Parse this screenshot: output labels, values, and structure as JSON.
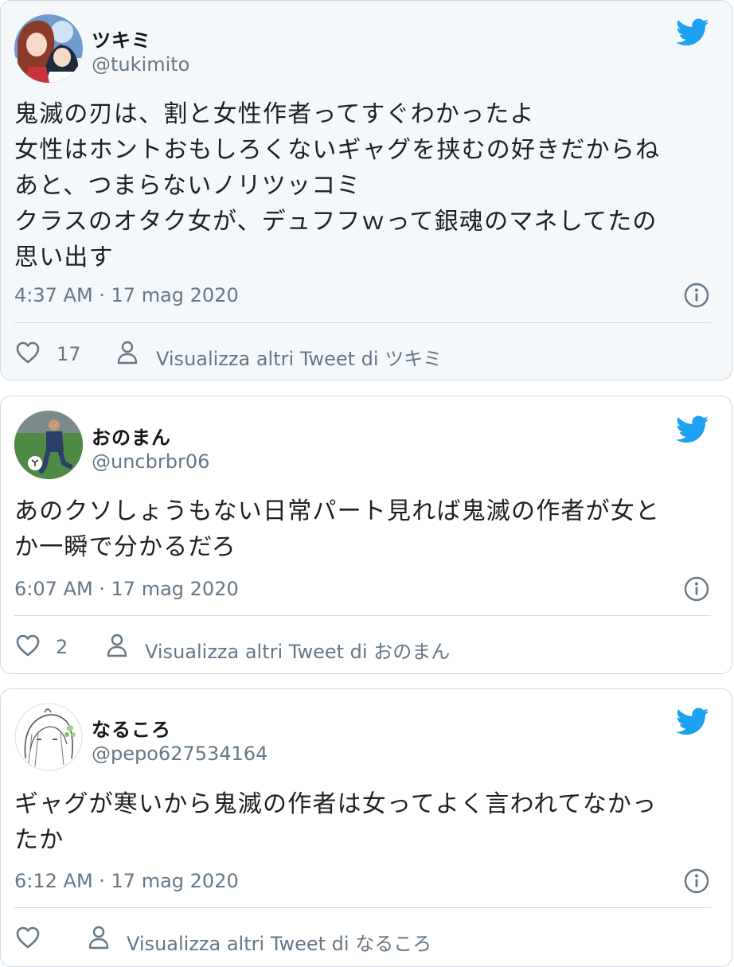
{
  "tweets": [
    {
      "display_name": "ツキミ",
      "handle": "@tukimito",
      "text_lines": [
        "鬼滅の刃は、割と女性作者ってすぐわかったよ",
        "女性はホントおもしろくないギャグを挟むの好きだからね",
        "あと、つまらないノリツッコミ",
        "クラスのオタク女が、デュフフｗって銀魂のマネしてたの",
        "思い出す"
      ],
      "timestamp": "4:37 AM · 17 mag 2020",
      "likes": "17",
      "more_label": "Visualizza altri Tweet di ツキミ",
      "avatar_icon": "anime-girls-avatar"
    },
    {
      "display_name": "おのまん",
      "handle": "@uncbrbr06",
      "text_lines": [
        "あのクソしょうもない日常パート見れば鬼滅の作者が女と",
        "か一瞬で分かるだろ"
      ],
      "timestamp": "6:07 AM · 17 mag 2020",
      "likes": "2",
      "more_label": "Visualizza altri Tweet di おのまん",
      "avatar_icon": "soccer-player-avatar"
    },
    {
      "display_name": "なるころ",
      "handle": "@pepo627534164",
      "text_lines": [
        "ギャグが寒いから鬼滅の作者は女ってよく言われてなかっ",
        "たか"
      ],
      "timestamp": "6:12 AM · 17 mag 2020",
      "likes": "",
      "more_label": "Visualizza altri Tweet di なるころ",
      "avatar_icon": "sketch-girl-avatar"
    }
  ],
  "icons": {
    "brand": "twitter-bird-icon",
    "info": "info-icon",
    "like": "heart-icon",
    "profile": "person-icon"
  },
  "colors": {
    "twitter_blue": "#1da1f2",
    "secondary_text": "#657786",
    "border": "#cfd9de"
  }
}
